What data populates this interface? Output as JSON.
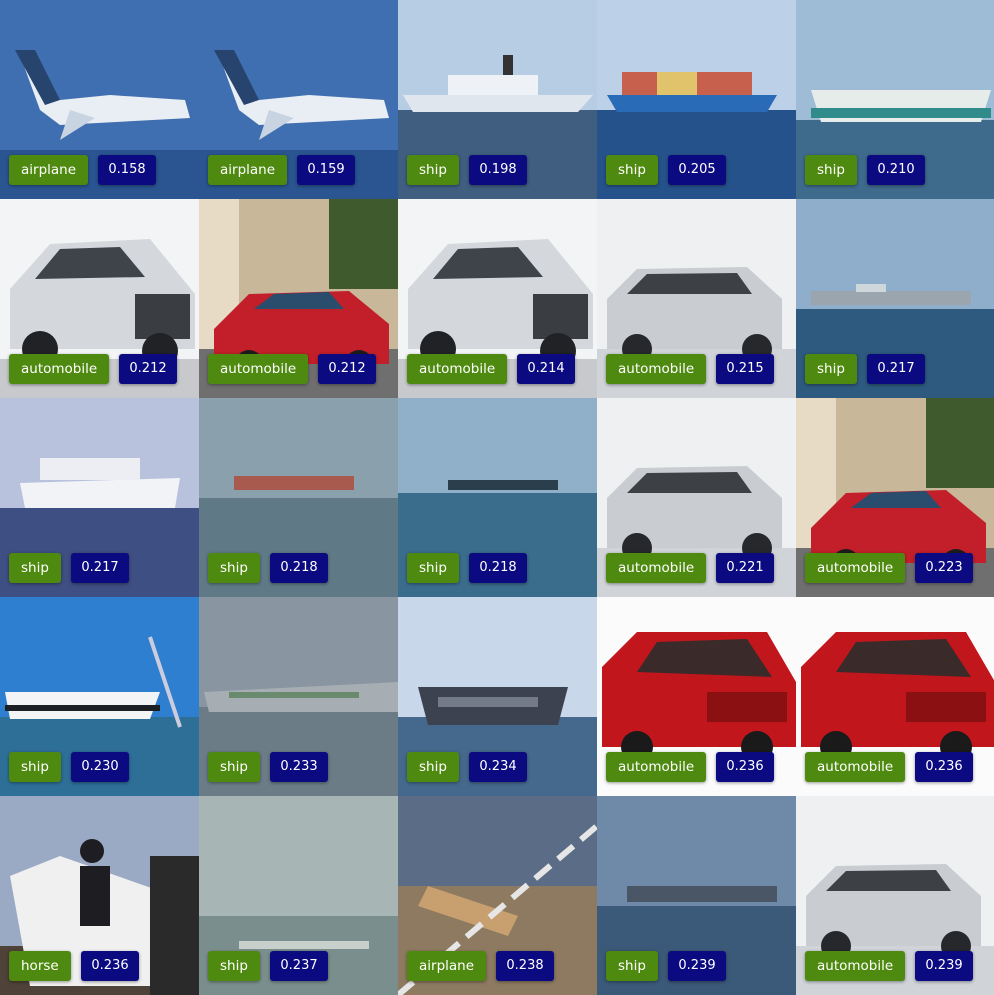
{
  "colors": {
    "label_bg": "#4f8a10",
    "score_bg": "#0b0a80",
    "highlight": "#f07020"
  },
  "tiles": [
    {
      "label": "airplane",
      "score": "0.158",
      "highlighted": true,
      "scene": "airplane"
    },
    {
      "label": "airplane",
      "score": "0.159",
      "highlighted": true,
      "scene": "airplane"
    },
    {
      "label": "ship",
      "score": "0.198",
      "highlighted": false,
      "scene": "ship-cruise"
    },
    {
      "label": "ship",
      "score": "0.205",
      "highlighted": false,
      "scene": "ship-container"
    },
    {
      "label": "ship",
      "score": "0.210",
      "highlighted": false,
      "scene": "ship-ferry"
    },
    {
      "label": "automobile",
      "score": "0.212",
      "highlighted": true,
      "scene": "car-white"
    },
    {
      "label": "automobile",
      "score": "0.212",
      "highlighted": false,
      "scene": "car-red-street"
    },
    {
      "label": "automobile",
      "score": "0.214",
      "highlighted": true,
      "scene": "car-white"
    },
    {
      "label": "automobile",
      "score": "0.215",
      "highlighted": false,
      "scene": "car-silver"
    },
    {
      "label": "ship",
      "score": "0.217",
      "highlighted": false,
      "scene": "ship-distant"
    },
    {
      "label": "ship",
      "score": "0.217",
      "highlighted": false,
      "scene": "ship-white"
    },
    {
      "label": "ship",
      "score": "0.218",
      "highlighted": false,
      "scene": "ship-hazy"
    },
    {
      "label": "ship",
      "score": "0.218",
      "highlighted": false,
      "scene": "ship-hazy-blue"
    },
    {
      "label": "automobile",
      "score": "0.221",
      "highlighted": false,
      "scene": "car-silver"
    },
    {
      "label": "automobile",
      "score": "0.223",
      "highlighted": false,
      "scene": "car-red-street"
    },
    {
      "label": "ship",
      "score": "0.230",
      "highlighted": false,
      "scene": "ship-crane"
    },
    {
      "label": "ship",
      "score": "0.233",
      "highlighted": false,
      "scene": "ship-grey"
    },
    {
      "label": "ship",
      "score": "0.234",
      "highlighted": false,
      "scene": "ship-dark"
    },
    {
      "label": "automobile",
      "score": "0.236",
      "highlighted": true,
      "scene": "car-red"
    },
    {
      "label": "automobile",
      "score": "0.236",
      "highlighted": true,
      "scene": "car-red"
    },
    {
      "label": "horse",
      "score": "0.236",
      "highlighted": false,
      "scene": "horse"
    },
    {
      "label": "ship",
      "score": "0.237",
      "highlighted": false,
      "scene": "ship-faint"
    },
    {
      "label": "airplane",
      "score": "0.238",
      "highlighted": false,
      "scene": "airplane-ground"
    },
    {
      "label": "ship",
      "score": "0.239",
      "highlighted": false,
      "scene": "ship-distant-dark"
    },
    {
      "label": "automobile",
      "score": "0.239",
      "highlighted": false,
      "scene": "car-silver"
    }
  ]
}
